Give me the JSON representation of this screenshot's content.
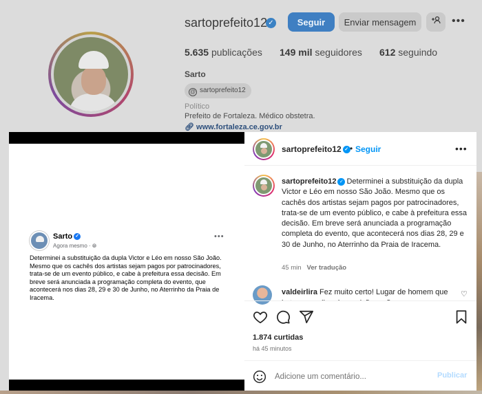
{
  "profile": {
    "username": "sartoprefeito12",
    "follow_label": "Seguir",
    "message_label": "Enviar mensagem",
    "add_user_icon": "+°",
    "more_icon": "•••",
    "stats": {
      "posts_count": "5.635",
      "posts_label": "publicações",
      "followers_count": "149 mil",
      "followers_label": "seguidores",
      "following_count": "612",
      "following_label": "seguindo"
    },
    "name": "Sarto",
    "threads_handle": "sartoprefeito12",
    "category": "Político",
    "bio": "Prefeito de Fortaleza. Médico obstetra.",
    "website": "www.fortaleza.ce.gov.br"
  },
  "media": {
    "fb_name": "Sarto",
    "fb_time": "Agora mesmo · ",
    "fb_more": "•••",
    "fb_text": "Determinei a substituição da dupla Victor e Léo em nosso São João. Mesmo que os cachês dos artistas sejam pagos por patrocinadores, trata-se de um evento público, e cabe à prefeitura essa decisão. Em breve será anunciada a programação completa do evento, que acontecerá nos dias 28, 29 e 30 de Junho, no Aterrinho da Praia de Iracema."
  },
  "post": {
    "username": "sartoprefeito12",
    "dot": "•",
    "follow_label": "Seguir",
    "more_icon": "•••",
    "caption_user": "sartoprefeito12",
    "caption_text": "Determinei a substituição da dupla Victor e Léo em nosso São João. Mesmo que os cachês dos artistas sejam pagos por patrocinadores, trata-se de um evento público, e cabe à prefeitura essa decisão. Em breve será anunciada a programação completa do evento, que acontecerá nos dias 28, 29 e 30 de Junho, no Aterrinho da Praia de Iracema.",
    "caption_time": "45 min",
    "translate_label": "Ver tradução",
    "comment_user": "valdeirlira",
    "comment_text": "Fez muito certo! Lugar de homem que bate em mulher é na prisão e não em",
    "likes": "1.874 curtidas",
    "post_time": "há 45 minutos",
    "comment_placeholder": "Adicione um comentário...",
    "publish_label": "Publicar"
  },
  "icons": {
    "verified": "✓",
    "like": "heart-icon",
    "comment": "comment-icon",
    "share": "send-icon",
    "save": "bookmark-icon",
    "emoji": "emoji-icon",
    "comment_like": "♡"
  },
  "colors": {
    "accent_blue": "#0095f6",
    "follow_button_dimmed": "#3f7fc2"
  }
}
